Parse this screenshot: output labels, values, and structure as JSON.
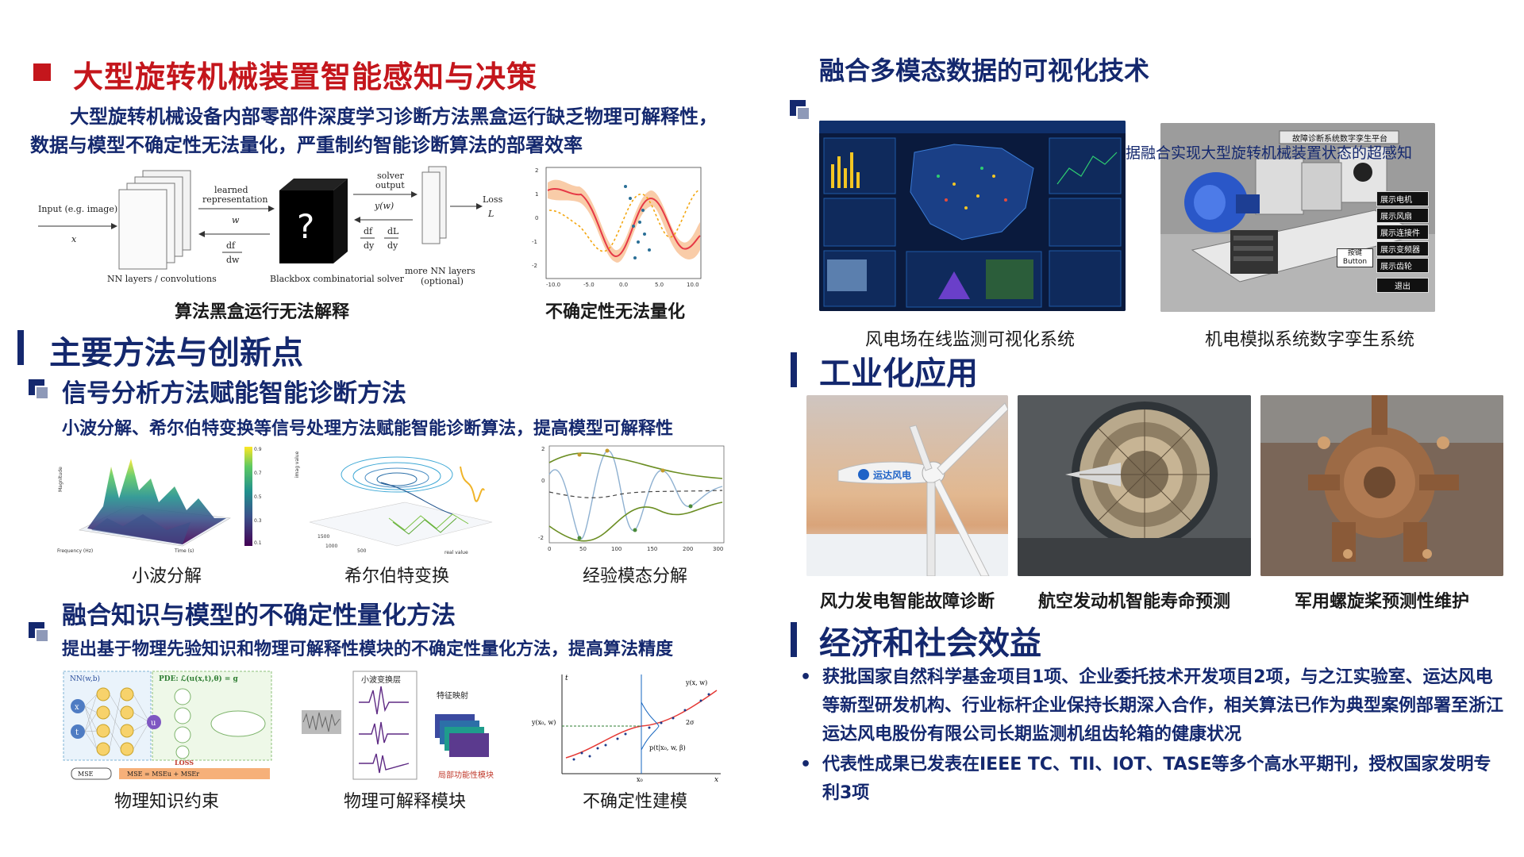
{
  "left": {
    "title": "大型旋转机械装置智能感知与决策",
    "intro_line1": "大型旋转机械设备内部零部件深度学习诊断方法黑盒运行缺乏物理可解释性，",
    "intro_line2": "数据与模型不确定性无法量化，严重制约智能诊断算法的部署效率",
    "fig1": {
      "input_label": "Input (e.g. image)",
      "input_var": "x",
      "learned_label": "learned",
      "repr_label": "representation",
      "w_var": "w",
      "dfl": "df",
      "dw": "dw",
      "nn_label": "NN layers / convolutions",
      "box_label": "Blackbox combinatorial solver",
      "solver_label": "solver",
      "output_label": "output",
      "yw": "y(w)",
      "df": "df",
      "dy": "dy",
      "dL": "dL",
      "more_nn": "more NN layers",
      "optional": "(optional)",
      "loss": "Loss",
      "L": "L"
    },
    "caption_blackbox": "算法黑盒运行无法解释",
    "caption_uncertainty": "不确定性无法量化",
    "section_title": "主要方法与创新点",
    "sub1_title": "信号分析方法赋能智能诊断方法",
    "sub1_desc": "小波分解、希尔伯特变换等信号处理方法赋能智能诊断算法，提高模型可解释性",
    "captions_row2": [
      "小波分解",
      "希尔伯特变换",
      "经验模态分解"
    ],
    "sub2_title": "融合知识与模型的不确定性量化方法",
    "sub2_desc": "提出基于物理先验知识和物理可解释性模块的不确定性量化方法，提高算法精度",
    "fig_nn": {
      "nn": "NN(w,b)",
      "pde": "PDE: ℒ(u(x,t),θ) = g",
      "loss": "LOSS",
      "mse": "MSE",
      "mse_eq": "MSE = MSEu + MSEr",
      "nodes": [
        "x",
        "t",
        "σ",
        "u"
      ]
    },
    "fig_wavelet": {
      "layer_label": "小波变换层",
      "map_label": "特征映射",
      "module_label": "局部功能性模块"
    },
    "fig_unc": {
      "y_label": "y(x₀, w)",
      "sigma": "2σ",
      "p_label": "p(t|x₀, w, β)",
      "x0": "x₀",
      "ylabel": "t",
      "xlabel": "x",
      "curve": "y(x, w)"
    },
    "captions_row3": [
      "物理知识约束",
      "物理可解释模块",
      "不确定性建模"
    ]
  },
  "right": {
    "title1": "融合多模态数据的可视化技术",
    "overlay_text": "据融合实现大型旋转机械装置状态的超感知",
    "twin_title": "故障诊断系统数字孪生平台",
    "twin_buttons": [
      "展示电机",
      "展示风扇",
      "展示连接件",
      "展示变频器",
      "展示齿轮",
      "退出"
    ],
    "twin_button_label": "按键",
    "twin_button_en": "Button",
    "caption_wind_system": "风电场在线监测可视化系统",
    "caption_twin": "机电模拟系统数字孪生系统",
    "title2": "工业化应用",
    "turbine_brand": "运达风电",
    "captions_apps": [
      "风力发电智能故障诊断",
      "航空发动机智能寿命预测",
      "军用螺旋桨预测性维护"
    ],
    "title3": "经济和社会效益",
    "bullets": [
      "获批国家自然科学基金项目1项、企业委托技术开发项目2项，与之江实验室、运达风电等新型研发机构、行业标杆企业保持长期深入合作，相关算法已作为典型案例部署至浙江运达风电股份有限公司长期监测机组齿轮箱的健康状况",
      "代表性成果已发表在IEEE TC、TII、IOT、TASE等多个高水平期刊，授权国家发明专利3项"
    ]
  },
  "colors": {
    "title_red": "#c4161c",
    "navy": "#14286e",
    "icon_gray": "#8e99b8"
  }
}
